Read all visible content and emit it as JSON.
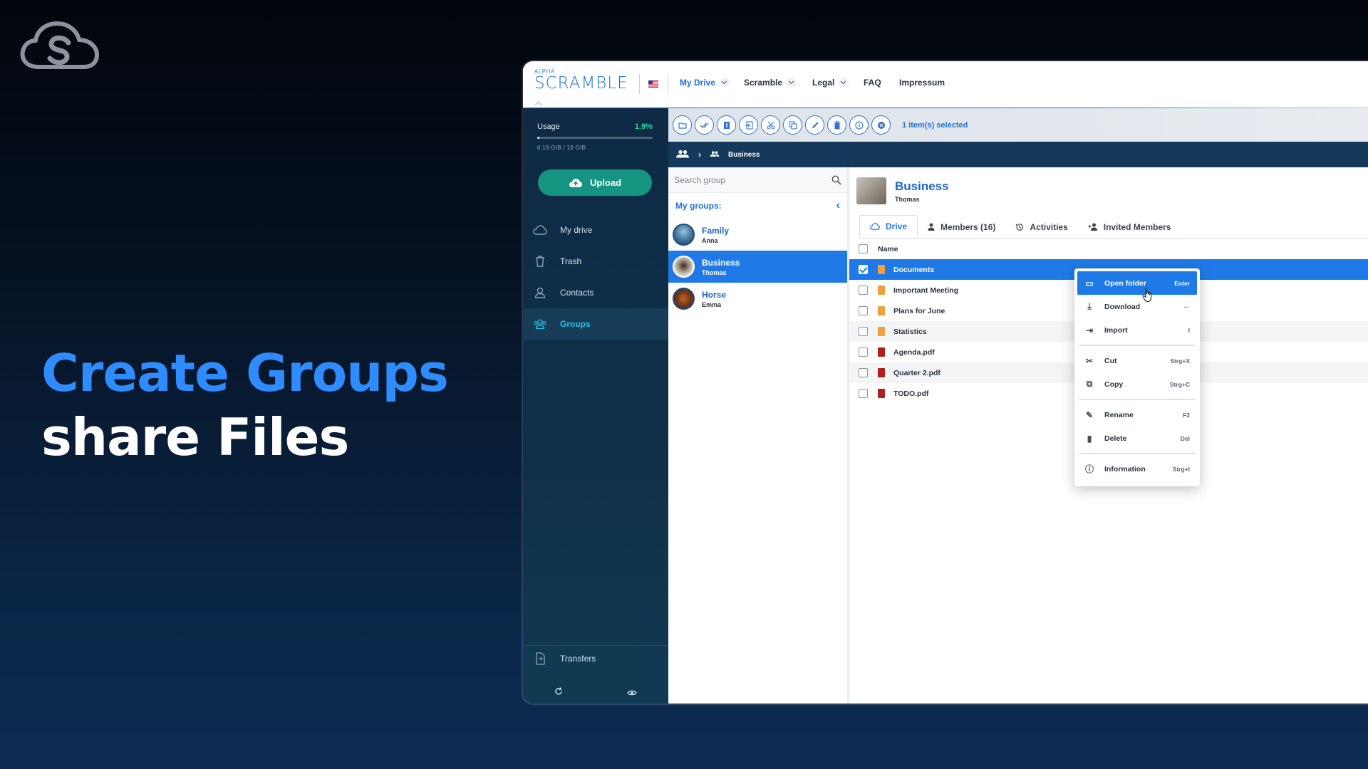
{
  "hero": {
    "line1": "Create Groups",
    "line2": "share Files"
  },
  "app": {
    "logo_alpha": "ALPHA",
    "logo_name": "SCRAMBLE",
    "nav": [
      {
        "label": "My Drive",
        "active": true
      },
      {
        "label": "Scramble"
      },
      {
        "label": "Legal"
      },
      {
        "label": "FAQ"
      },
      {
        "label": "Impressum"
      }
    ]
  },
  "sidebar": {
    "usage_label": "Usage",
    "usage_percent": "1.9%",
    "usage_fraction": 0.019,
    "usage_detail": "0.19 GIB / 10 GIB",
    "upload_label": "Upload",
    "items": [
      {
        "label": "My drive",
        "icon": "cloud-icon"
      },
      {
        "label": "Trash",
        "icon": "trash-icon"
      },
      {
        "label": "Contacts",
        "icon": "person-icon"
      },
      {
        "label": "Groups",
        "icon": "groups-icon",
        "active": true
      }
    ],
    "transfers_label": "Transfers"
  },
  "toolbar": {
    "selection_status": "1 item(s) selected"
  },
  "breadcrumb": {
    "current": "Business"
  },
  "groups": {
    "search_placeholder": "Search group",
    "header": "My groups:",
    "list": [
      {
        "name": "Family",
        "owner": "Anna"
      },
      {
        "name": "Business",
        "owner": "Thomas",
        "selected": true
      },
      {
        "name": "Horse",
        "owner": "Emma"
      }
    ]
  },
  "group_detail": {
    "title": "Business",
    "owner": "Thomas",
    "tabs": [
      {
        "label": "Drive",
        "active": true
      },
      {
        "label": "Members (16)"
      },
      {
        "label": "Activities"
      },
      {
        "label": "Invited Members"
      }
    ],
    "column_name": "Name",
    "files": [
      {
        "name": "Documents",
        "type": "folder",
        "selected": true
      },
      {
        "name": "Important Meeting",
        "type": "folder"
      },
      {
        "name": "Plans for June",
        "type": "folder"
      },
      {
        "name": "Statistics",
        "type": "folder"
      },
      {
        "name": "Agenda.pdf",
        "type": "pdf"
      },
      {
        "name": "Quarter 2.pdf",
        "type": "pdf"
      },
      {
        "name": "TODO.pdf",
        "type": "pdf"
      }
    ]
  },
  "context_menu": {
    "items": [
      {
        "label": "Open folder",
        "shortcut": "Enter"
      },
      {
        "label": "Download",
        "shortcut": "···"
      },
      {
        "label": "Import",
        "shortcut": "I"
      },
      {
        "label": "Cut",
        "shortcut": "Strg+X"
      },
      {
        "label": "Copy",
        "shortcut": "Strg+C"
      },
      {
        "label": "Rename",
        "shortcut": "F2"
      },
      {
        "label": "Delete",
        "shortcut": "Del"
      },
      {
        "label": "Information",
        "shortcut": "Strg+I"
      }
    ]
  },
  "colors": {
    "accent": "#1f7ae8",
    "brand_teal": "#159482",
    "hero_blue": "#2e8cff"
  }
}
